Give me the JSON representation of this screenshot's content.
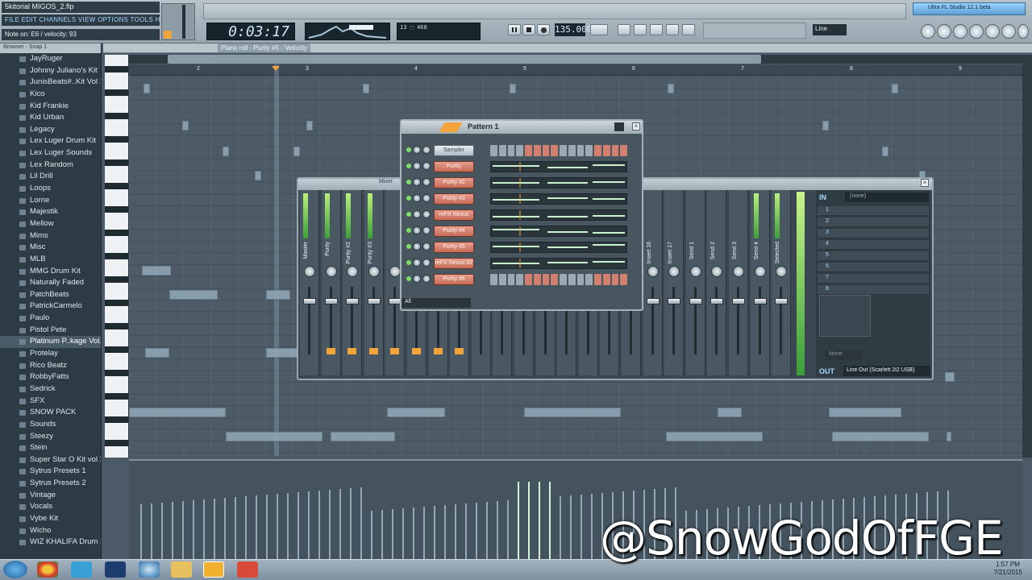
{
  "window": {
    "project_title": "5kitorial MIGOS_2.flp",
    "menu_text": "FILE EDIT CHANNELS VIEW OPTIONS TOOLS HELP",
    "hint": "Note on: E6 / velocity: 93"
  },
  "transport": {
    "time": "0:03:17",
    "bpm": "135.000",
    "snap": "Line",
    "cpu": "13 ⬚ 468",
    "hint_panel": "Ultra FL Studio 12.1 beta"
  },
  "browser": {
    "header": "Browser - Snap 1",
    "items": [
      "JayRuger",
      "Johnny Juliano's Kit",
      "JunisBeats#..Kit Vol 1",
      "Kico",
      "Kid Frankie",
      "Kid Urban",
      "Legacy",
      "Lex Luger Drum Kit",
      "Lex Luger Sounds",
      "Lex Random",
      "Lil Drill",
      "Loops",
      "Lorne",
      "Majestik",
      "Mellow",
      "Mims",
      "Misc",
      "MLB",
      "MMG Drum Kit",
      "Naturally Faded",
      "PatchBeats",
      "PatrickCarmelo",
      "Paulo",
      "Pistol Pete",
      "Platinum P..kage Vol.1",
      "Protelay",
      "Rico Beatz",
      "RobbyFatts",
      "Sedrick",
      "SFX",
      "SNOW PACK",
      "Sounds",
      "Steezy",
      "Stein",
      "Super Star O Kit vol 2",
      "Sytrus Presets 1",
      "Sytrus Presets 2",
      "Vintage",
      "Vocals",
      "Vybe Kit",
      "Wicho",
      "WIZ KHALIFA Drum Kit"
    ],
    "selected_index": 24
  },
  "piano_roll": {
    "title": "Piano roll - Purity #5 - Velocity",
    "bars": [
      "2",
      "3",
      "4",
      "5",
      "6",
      "7",
      "8",
      "9"
    ]
  },
  "mixer": {
    "title": "Mixer",
    "strips": [
      "Master",
      "Purity",
      "Purity #2",
      "Purity #3",
      "",
      "",
      "",
      "",
      "",
      "",
      "",
      "",
      "",
      "",
      "",
      "",
      "Insert 16",
      "Insert 17",
      "Send 1",
      "Send 2",
      "Send 3",
      "Send 4",
      "Selected"
    ],
    "fx_input": "(none)",
    "slots": [
      "1",
      "2",
      "3",
      "4",
      "5",
      "6",
      "7",
      "8"
    ],
    "in_label": "IN",
    "out_label": "OUT",
    "output": "Line Out (Scarlett 2i2 USB)",
    "none_label": "None"
  },
  "channel_rack": {
    "title": "Pattern 1",
    "filter": "All",
    "channels": [
      "Sampler",
      "Purity",
      "Purity #2",
      "Purity #3",
      "reFX Nexus",
      "Purity #4",
      "Purity #5",
      "reFX Nexus #2",
      "Purity #6"
    ]
  },
  "taskbar": {
    "time": "1:57 PM",
    "date": "7/21/2015"
  },
  "watermark": "@SnowGodOfFGE",
  "colors": {
    "accent_orange": "#f2a33a",
    "channel_red": "#d27f70",
    "meter_green": "#7cde6a"
  }
}
